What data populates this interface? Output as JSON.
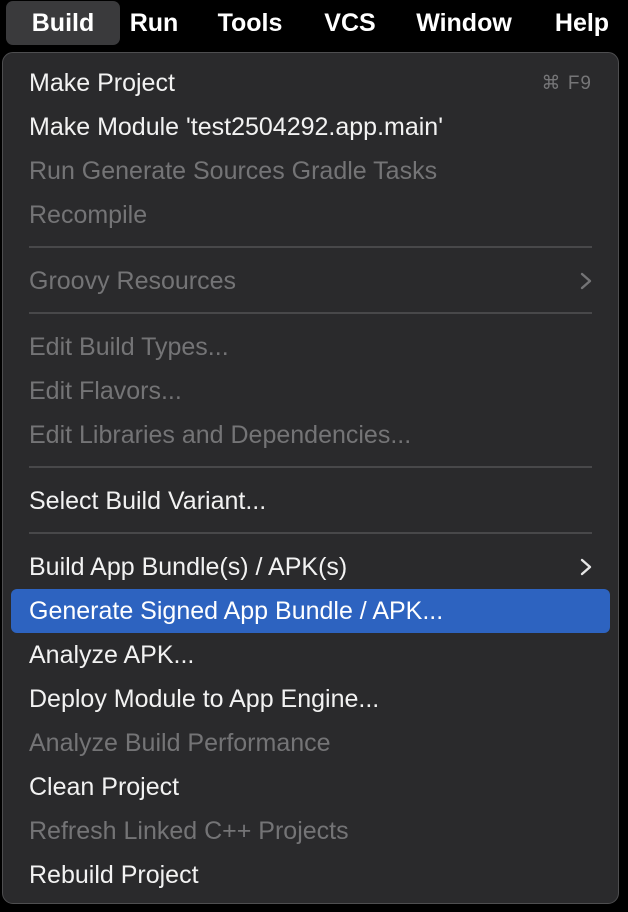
{
  "menubar": {
    "items": [
      {
        "label": "Build",
        "active": true
      },
      {
        "label": "Run"
      },
      {
        "label": "Tools"
      },
      {
        "label": "VCS"
      },
      {
        "label": "Window"
      },
      {
        "label": "Help"
      }
    ]
  },
  "build_menu": {
    "items": [
      {
        "label": "Make Project",
        "shortcut": "⌘ F9",
        "enabled": true
      },
      {
        "label": "Make Module 'test2504292.app.main'",
        "enabled": true
      },
      {
        "label": "Run Generate Sources Gradle Tasks",
        "enabled": false
      },
      {
        "label": "Recompile",
        "enabled": false
      },
      {
        "label": "Groovy Resources",
        "enabled": false,
        "submenu": true,
        "icon": "chevron-right-icon"
      },
      {
        "label": "Edit Build Types...",
        "enabled": false
      },
      {
        "label": "Edit Flavors...",
        "enabled": false
      },
      {
        "label": "Edit Libraries and Dependencies...",
        "enabled": false
      },
      {
        "label": "Select Build Variant...",
        "enabled": true
      },
      {
        "label": "Build App Bundle(s) / APK(s)",
        "enabled": true,
        "submenu": true,
        "icon": "chevron-right-icon"
      },
      {
        "label": "Generate Signed App Bundle / APK...",
        "enabled": true,
        "highlighted": true
      },
      {
        "label": "Analyze APK...",
        "enabled": true
      },
      {
        "label": "Deploy Module to App Engine...",
        "enabled": true
      },
      {
        "label": "Analyze Build Performance",
        "enabled": false
      },
      {
        "label": "Clean Project",
        "enabled": true
      },
      {
        "label": "Refresh Linked C++ Projects",
        "enabled": false
      },
      {
        "label": "Rebuild Project",
        "enabled": true
      }
    ]
  },
  "colors": {
    "highlight": "#2d63c0",
    "menu_background": "#2a2a2c",
    "enabled_text": "#f2f2f2",
    "disabled_text": "#747476"
  }
}
